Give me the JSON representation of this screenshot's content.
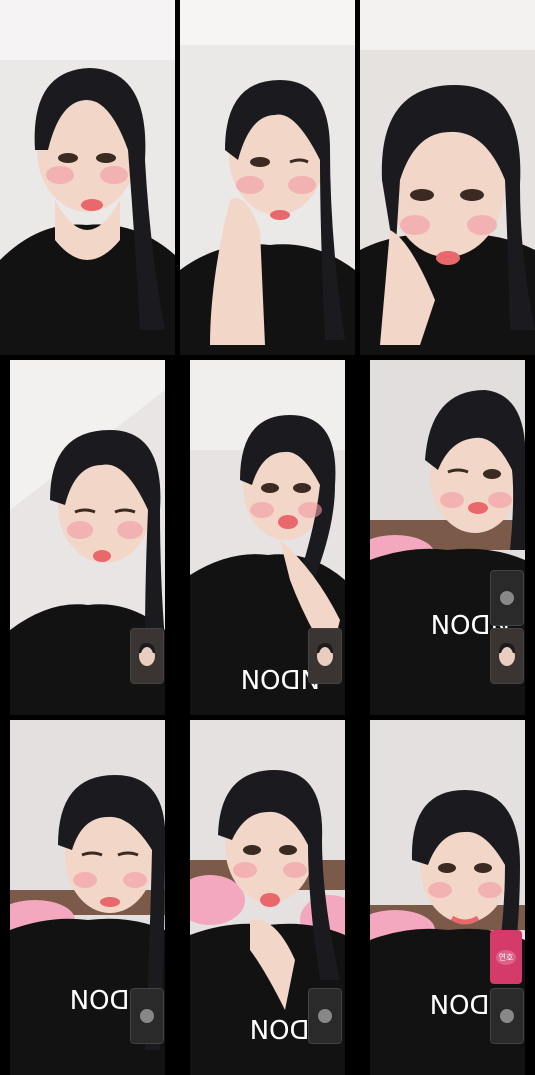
{
  "grid": {
    "tiles": [
      {
        "row": 0,
        "col": 0,
        "shirt_text": ""
      },
      {
        "row": 0,
        "col": 1,
        "shirt_text": ""
      },
      {
        "row": 0,
        "col": 2,
        "shirt_text": ""
      },
      {
        "row": 1,
        "col": 0,
        "shirt_text": ""
      },
      {
        "row": 1,
        "col": 1,
        "shirt_text": "NDON"
      },
      {
        "row": 1,
        "col": 2,
        "shirt_text": "NDON"
      },
      {
        "row": 2,
        "col": 0,
        "shirt_text": "NDON"
      },
      {
        "row": 2,
        "col": 1,
        "shirt_text": "NDON"
      },
      {
        "row": 2,
        "col": 2,
        "shirt_text": "NDON"
      }
    ],
    "pip_pink_label": "연호"
  },
  "colors": {
    "wall": "#e9e6e6",
    "skin": "#f2d6c8",
    "hair": "#1b1b1f",
    "shirt": "#111112",
    "blush": "#f29aa2",
    "lip": "#e8686c",
    "pillow": "#f4a8bf",
    "pip_accent": "#d43b6a"
  }
}
